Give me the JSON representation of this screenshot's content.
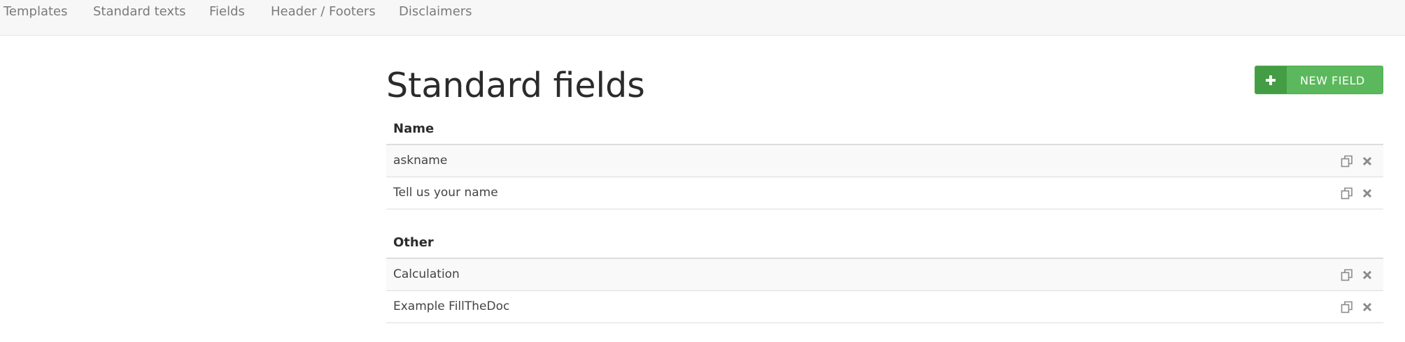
{
  "nav": {
    "items": [
      {
        "label": "Templates"
      },
      {
        "label": "Standard texts"
      },
      {
        "label": "Fields"
      },
      {
        "label": "Header / Footers"
      },
      {
        "label": "Disclaimers"
      }
    ]
  },
  "page": {
    "title": "Standard fields",
    "new_button_label": "NEW FIELD",
    "new_button_icon": "plus-icon"
  },
  "groups": [
    {
      "name": "Name",
      "rows": [
        {
          "label": "askname"
        },
        {
          "label": "Tell us your name"
        }
      ]
    },
    {
      "name": "Other",
      "rows": [
        {
          "label": "Calculation"
        },
        {
          "label": "Example FillTheDoc"
        }
      ]
    }
  ],
  "row_actions": [
    "copy-icon",
    "delete-icon"
  ],
  "colors": {
    "accent_green": "#5cb85c",
    "accent_green_dark": "#449d44",
    "nav_bg": "#f7f7f7",
    "icon_gray": "#8a8a8a"
  }
}
